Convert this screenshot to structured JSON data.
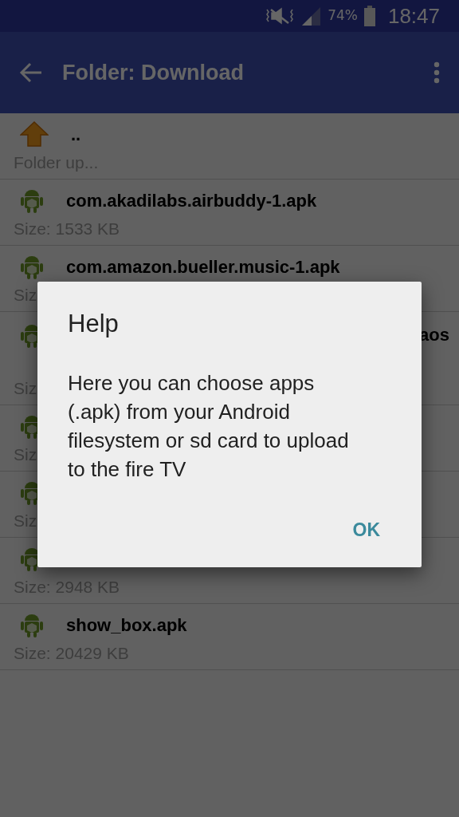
{
  "status_bar": {
    "battery_text": "74%",
    "time": "18:47"
  },
  "app_bar": {
    "title": "Folder: Download"
  },
  "parent_row": {
    "name": "..",
    "caption": "Folder up..."
  },
  "files": [
    {
      "kind": "full",
      "name": "com.akadilabs.airbuddy-1.apk",
      "size": "Size: 1533 KB"
    },
    {
      "kind": "full",
      "name": "com.amazon.bueller.music-1.apk",
      "size": "Siz"
    },
    {
      "kind": "tail",
      "name": "aos",
      "size": "Siz"
    },
    {
      "kind": "hidden",
      "size": "Siz"
    },
    {
      "kind": "hidden",
      "size": "Siz"
    },
    {
      "kind": "hidden",
      "size": "Size: 2948 KB"
    },
    {
      "kind": "full",
      "name": "show_box.apk",
      "size": "Size: 20429 KB"
    }
  ],
  "dialog": {
    "title": "Help",
    "message": "Here you can choose apps (.apk) from your Android filesystem or sd card to upload to the fire TV",
    "button": "OK"
  }
}
